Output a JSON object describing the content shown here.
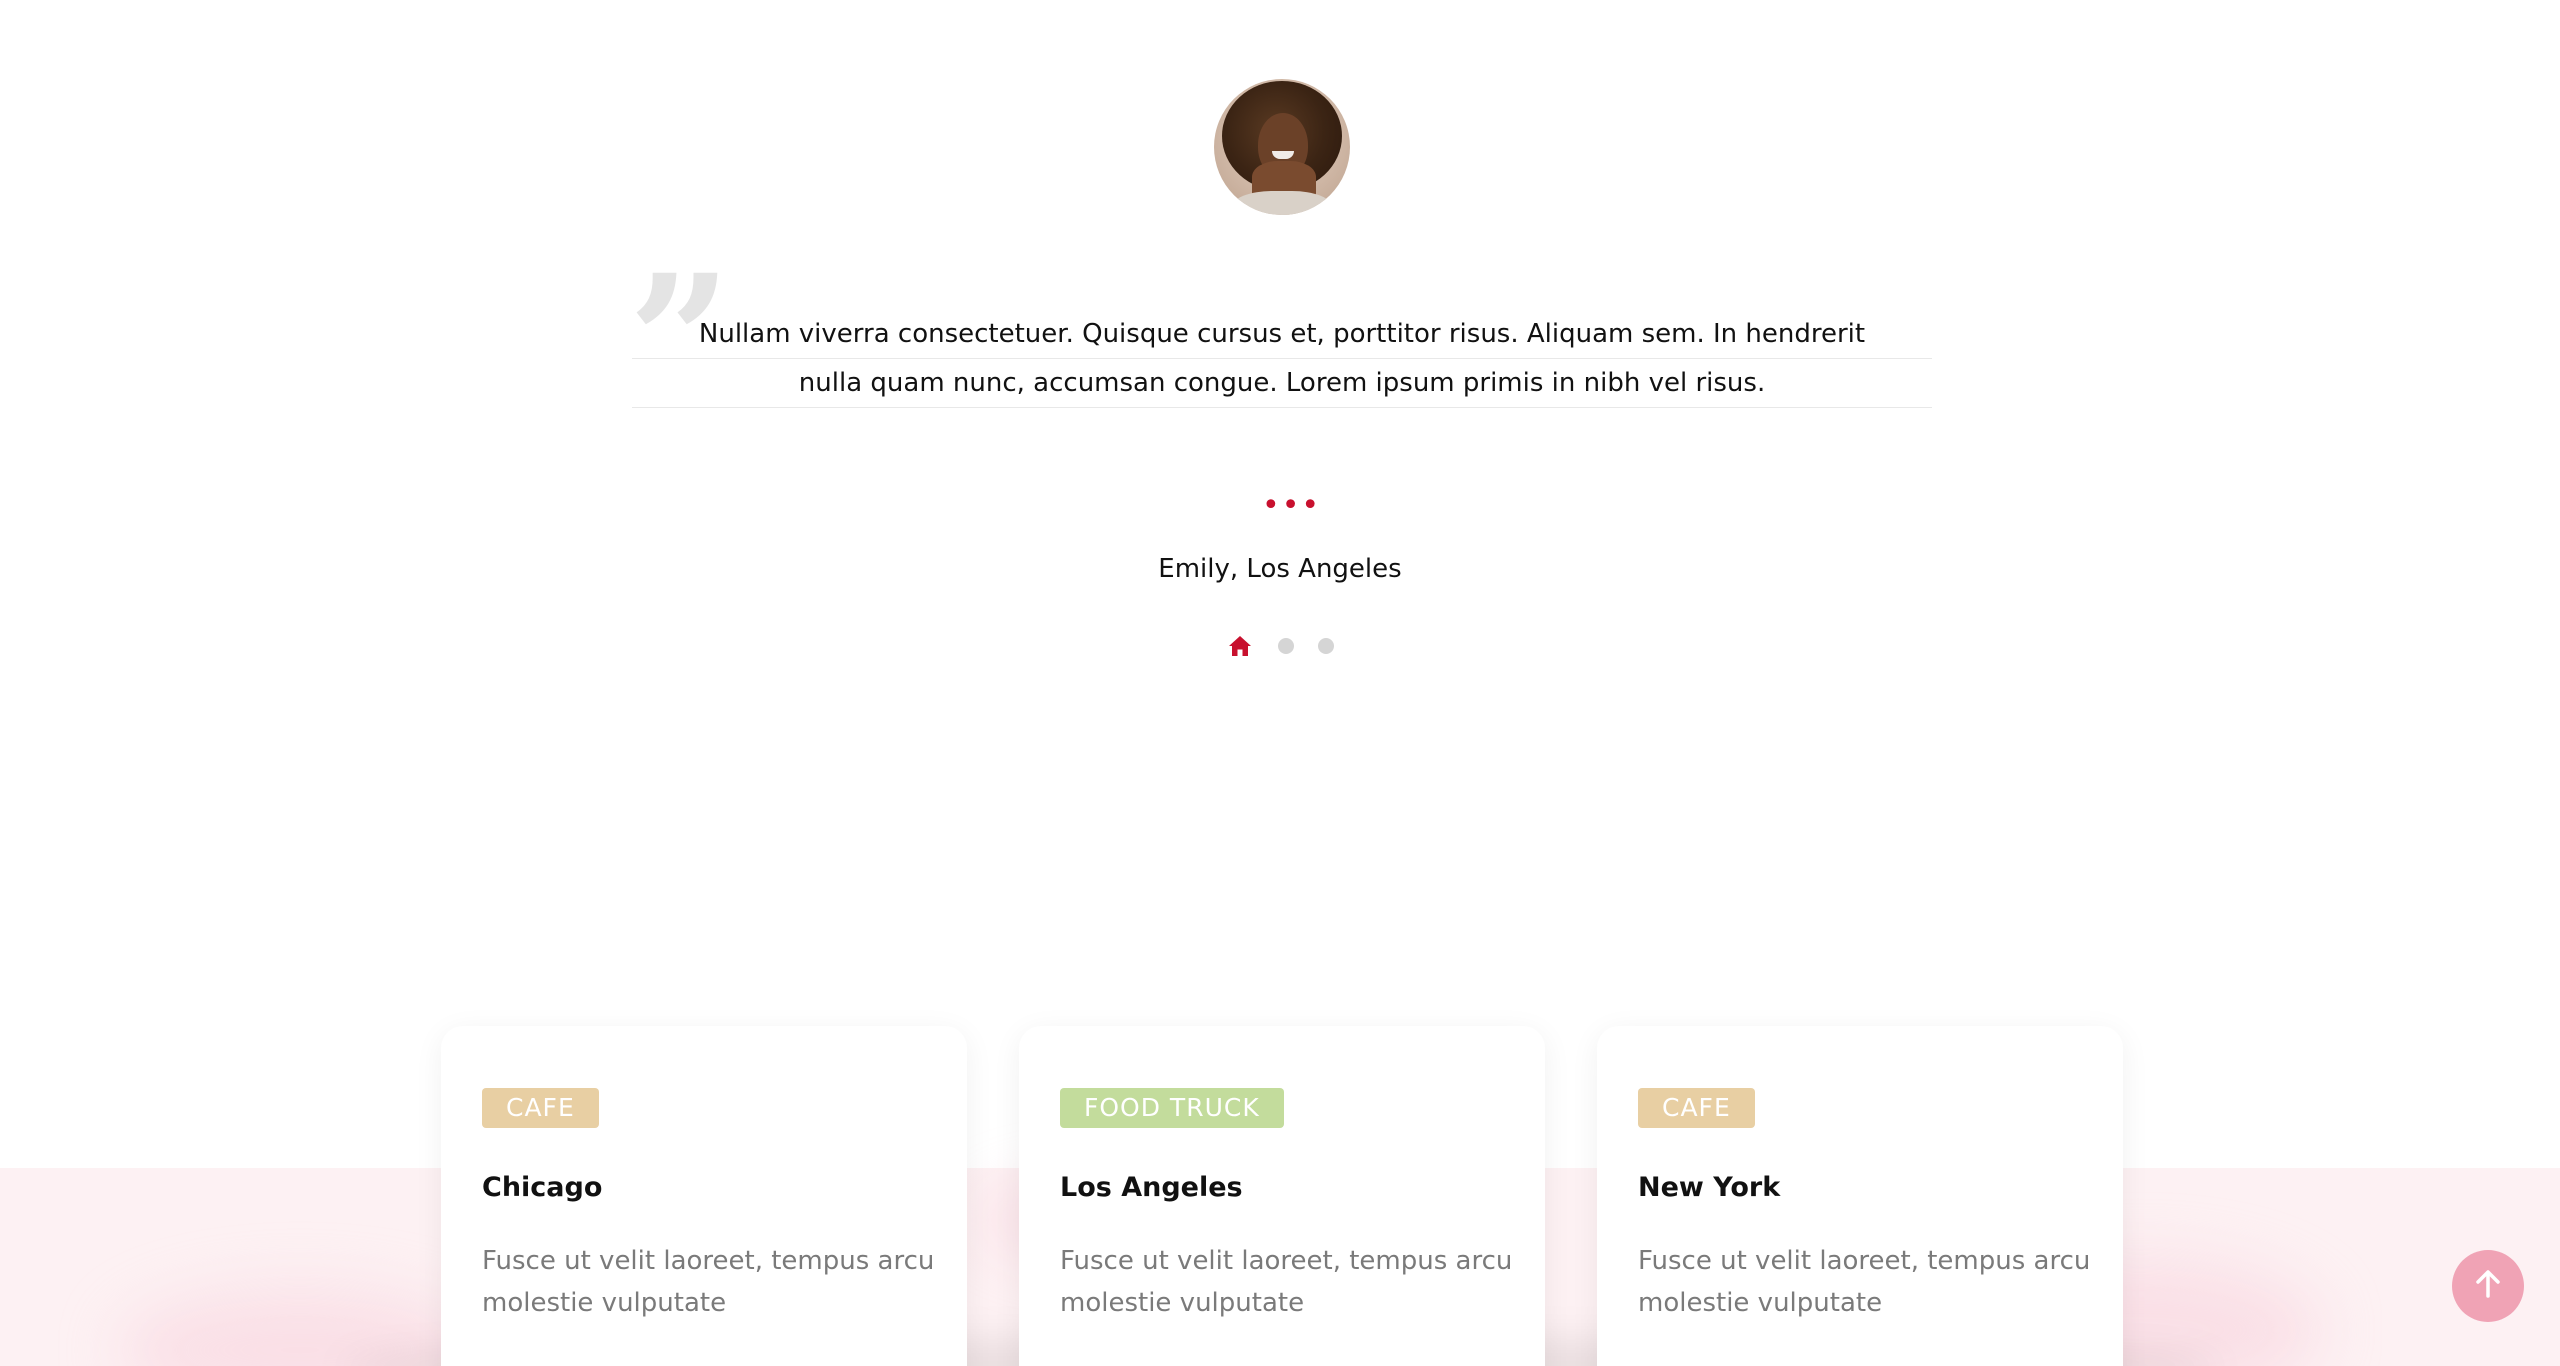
{
  "testimonial": {
    "quote_line1": "Nullam viverra consectetuer. Quisque cursus et, porttitor risus. Aliquam sem. In hendrerit",
    "quote_line2": "nulla quam nunc, accumsan congue. Lorem ipsum primis in nibh vel risus.",
    "divider": "•••",
    "author": "Emily, Los Angeles",
    "pager": {
      "active_icon": "home-icon",
      "dots": 2
    }
  },
  "cards": [
    {
      "tag": "CAFE",
      "tag_color": "#e8cfa3",
      "city": "Chicago",
      "description": "Fusce ut velit laoreet, tempus arcu molestie vulputate"
    },
    {
      "tag": "FOOD TRUCK",
      "tag_color": "#c3dc9c",
      "city": "Los Angeles",
      "description": "Fusce ut velit laoreet, tempus arcu molestie vulputate"
    },
    {
      "tag": "CAFE",
      "tag_color": "#e8cfa3",
      "city": "New York",
      "description": "Fusce ut velit laoreet, tempus arcu molestie vulputate"
    }
  ],
  "scroll_top": {
    "icon": "arrow-up-icon",
    "color": "#f0a3b5"
  },
  "colors": {
    "accent": "#c8102e",
    "band": "#fdf1f3"
  }
}
